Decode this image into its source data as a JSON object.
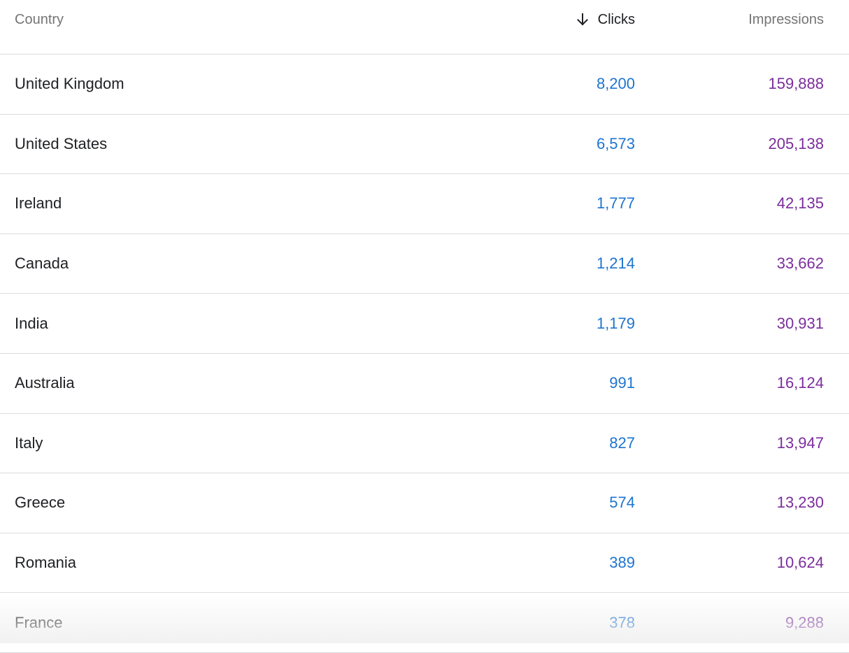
{
  "table": {
    "columns": {
      "country": "Country",
      "clicks": "Clicks",
      "impressions": "Impressions"
    },
    "sort": {
      "column": "clicks",
      "direction": "descending",
      "icon": "arrow-down-icon"
    },
    "colors": {
      "clicks": "#1e74d0",
      "impressions": "#7b2d9c"
    },
    "rows": [
      {
        "country": "United Kingdom",
        "clicks": "8,200",
        "impressions": "159,888"
      },
      {
        "country": "United States",
        "clicks": "6,573",
        "impressions": "205,138"
      },
      {
        "country": "Ireland",
        "clicks": "1,777",
        "impressions": "42,135"
      },
      {
        "country": "Canada",
        "clicks": "1,214",
        "impressions": "33,662"
      },
      {
        "country": "India",
        "clicks": "1,179",
        "impressions": "30,931"
      },
      {
        "country": "Australia",
        "clicks": "991",
        "impressions": "16,124"
      },
      {
        "country": "Italy",
        "clicks": "827",
        "impressions": "13,947"
      },
      {
        "country": "Greece",
        "clicks": "574",
        "impressions": "13,230"
      },
      {
        "country": "Romania",
        "clicks": "389",
        "impressions": "10,624"
      },
      {
        "country": "France",
        "clicks": "378",
        "impressions": "9,288"
      }
    ]
  }
}
